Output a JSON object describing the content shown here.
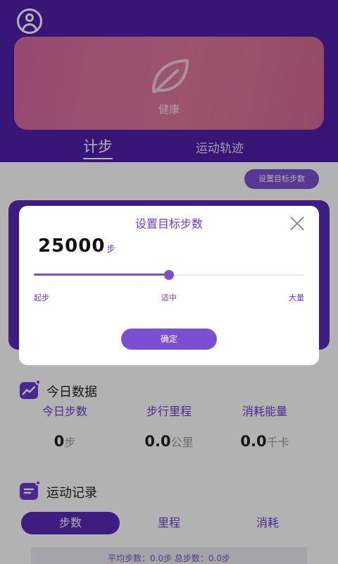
{
  "header": {
    "banner_caption": "健康",
    "tabs": [
      {
        "label": "计步",
        "active": true
      },
      {
        "label": "运动轨迹",
        "active": false
      }
    ]
  },
  "main": {
    "set_goal_button": "设置目标步数",
    "today": {
      "title": "今日数据",
      "stats": [
        {
          "label": "今日步数",
          "value": "0",
          "unit": "步"
        },
        {
          "label": "步行里程",
          "value": "0.0",
          "unit": "公里"
        },
        {
          "label": "消耗能量",
          "value": "0.0",
          "unit": "千卡"
        }
      ]
    },
    "records": {
      "title": "运动记录",
      "tabs": [
        {
          "label": "步数",
          "active": true
        },
        {
          "label": "里程",
          "active": false
        },
        {
          "label": "消耗",
          "active": false
        }
      ],
      "summary": "平均步数：0.0步 总步数：0.0步"
    }
  },
  "dialog": {
    "title": "设置目标步数",
    "value": "25000",
    "unit": "步",
    "slider_fraction": 0.5,
    "marks": {
      "low": "起步",
      "mid": "适中",
      "high": "大量"
    },
    "confirm_label": "确定"
  },
  "colors": {
    "accent": "#6b3ad0",
    "header_bg": "#4f1fa6",
    "banner_pink": "#e07a9d"
  }
}
